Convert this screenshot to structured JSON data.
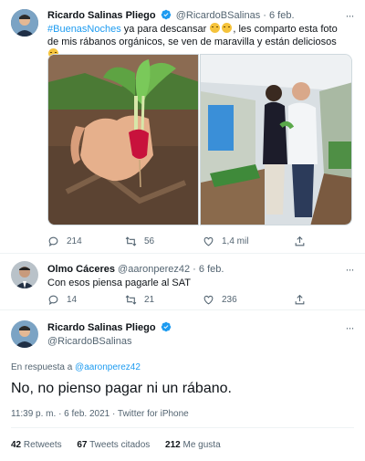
{
  "tweet1": {
    "name": "Ricardo Salinas Pliego",
    "handle": "@RicardoBSalinas",
    "time": "· 6 feb.",
    "hashtag": "#BuenasNoches",
    "text_a": " ya para descansar ",
    "text_b": ", les comparto esta foto de mis rábanos orgánicos, se ven de maravilla y están deliciosos ",
    "replies": "214",
    "retweets": "56",
    "likes": "1,4 mil"
  },
  "tweet2": {
    "name": "Olmo Cáceres",
    "handle": "@aaronperez42",
    "time": "· 6 feb.",
    "text": "Con esos piensa pagarle al SAT",
    "replies": "14",
    "retweets": "21",
    "likes": "236"
  },
  "tweet3": {
    "name": "Ricardo Salinas Pliego",
    "handle": "@RicardoBSalinas",
    "reply_prefix": "En respuesta a ",
    "reply_to": "@aaronperez42",
    "text": "No, no pienso pagar ni un rábano.",
    "timestamp": "11:39 p. m. · 6 feb. 2021 · Twitter for iPhone",
    "retweets_count": "42",
    "retweets_label": "Retweets",
    "quotes_count": "67",
    "quotes_label": "Tweets citados",
    "likes_count": "212",
    "likes_label": "Me gusta"
  },
  "colors": {
    "accent": "#1d9bf0",
    "secondary": "#536471",
    "border": "#eff3f4"
  }
}
